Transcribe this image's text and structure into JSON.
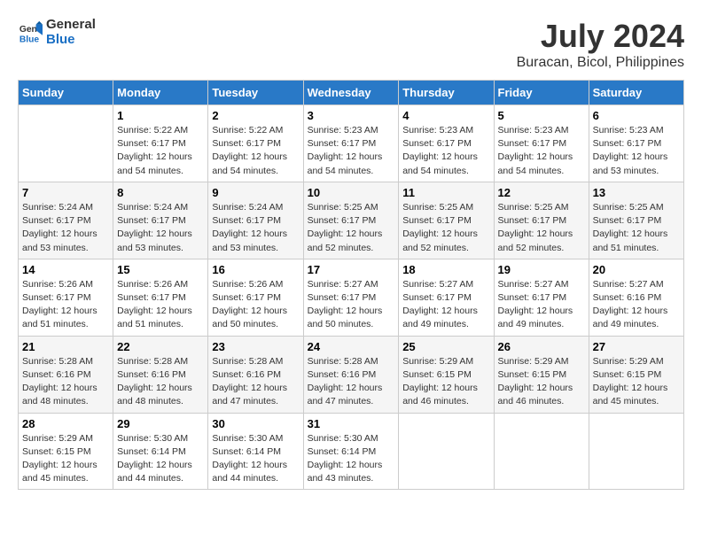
{
  "header": {
    "logo_general": "General",
    "logo_blue": "Blue",
    "title": "July 2024",
    "subtitle": "Buracan, Bicol, Philippines"
  },
  "days_of_week": [
    "Sunday",
    "Monday",
    "Tuesday",
    "Wednesday",
    "Thursday",
    "Friday",
    "Saturday"
  ],
  "weeks": [
    [
      {
        "day": "",
        "sunrise": "",
        "sunset": "",
        "daylight": ""
      },
      {
        "day": "1",
        "sunrise": "Sunrise: 5:22 AM",
        "sunset": "Sunset: 6:17 PM",
        "daylight": "Daylight: 12 hours and 54 minutes."
      },
      {
        "day": "2",
        "sunrise": "Sunrise: 5:22 AM",
        "sunset": "Sunset: 6:17 PM",
        "daylight": "Daylight: 12 hours and 54 minutes."
      },
      {
        "day": "3",
        "sunrise": "Sunrise: 5:23 AM",
        "sunset": "Sunset: 6:17 PM",
        "daylight": "Daylight: 12 hours and 54 minutes."
      },
      {
        "day": "4",
        "sunrise": "Sunrise: 5:23 AM",
        "sunset": "Sunset: 6:17 PM",
        "daylight": "Daylight: 12 hours and 54 minutes."
      },
      {
        "day": "5",
        "sunrise": "Sunrise: 5:23 AM",
        "sunset": "Sunset: 6:17 PM",
        "daylight": "Daylight: 12 hours and 54 minutes."
      },
      {
        "day": "6",
        "sunrise": "Sunrise: 5:23 AM",
        "sunset": "Sunset: 6:17 PM",
        "daylight": "Daylight: 12 hours and 53 minutes."
      }
    ],
    [
      {
        "day": "7",
        "sunrise": "Sunrise: 5:24 AM",
        "sunset": "Sunset: 6:17 PM",
        "daylight": "Daylight: 12 hours and 53 minutes."
      },
      {
        "day": "8",
        "sunrise": "Sunrise: 5:24 AM",
        "sunset": "Sunset: 6:17 PM",
        "daylight": "Daylight: 12 hours and 53 minutes."
      },
      {
        "day": "9",
        "sunrise": "Sunrise: 5:24 AM",
        "sunset": "Sunset: 6:17 PM",
        "daylight": "Daylight: 12 hours and 53 minutes."
      },
      {
        "day": "10",
        "sunrise": "Sunrise: 5:25 AM",
        "sunset": "Sunset: 6:17 PM",
        "daylight": "Daylight: 12 hours and 52 minutes."
      },
      {
        "day": "11",
        "sunrise": "Sunrise: 5:25 AM",
        "sunset": "Sunset: 6:17 PM",
        "daylight": "Daylight: 12 hours and 52 minutes."
      },
      {
        "day": "12",
        "sunrise": "Sunrise: 5:25 AM",
        "sunset": "Sunset: 6:17 PM",
        "daylight": "Daylight: 12 hours and 52 minutes."
      },
      {
        "day": "13",
        "sunrise": "Sunrise: 5:25 AM",
        "sunset": "Sunset: 6:17 PM",
        "daylight": "Daylight: 12 hours and 51 minutes."
      }
    ],
    [
      {
        "day": "14",
        "sunrise": "Sunrise: 5:26 AM",
        "sunset": "Sunset: 6:17 PM",
        "daylight": "Daylight: 12 hours and 51 minutes."
      },
      {
        "day": "15",
        "sunrise": "Sunrise: 5:26 AM",
        "sunset": "Sunset: 6:17 PM",
        "daylight": "Daylight: 12 hours and 51 minutes."
      },
      {
        "day": "16",
        "sunrise": "Sunrise: 5:26 AM",
        "sunset": "Sunset: 6:17 PM",
        "daylight": "Daylight: 12 hours and 50 minutes."
      },
      {
        "day": "17",
        "sunrise": "Sunrise: 5:27 AM",
        "sunset": "Sunset: 6:17 PM",
        "daylight": "Daylight: 12 hours and 50 minutes."
      },
      {
        "day": "18",
        "sunrise": "Sunrise: 5:27 AM",
        "sunset": "Sunset: 6:17 PM",
        "daylight": "Daylight: 12 hours and 49 minutes."
      },
      {
        "day": "19",
        "sunrise": "Sunrise: 5:27 AM",
        "sunset": "Sunset: 6:17 PM",
        "daylight": "Daylight: 12 hours and 49 minutes."
      },
      {
        "day": "20",
        "sunrise": "Sunrise: 5:27 AM",
        "sunset": "Sunset: 6:16 PM",
        "daylight": "Daylight: 12 hours and 49 minutes."
      }
    ],
    [
      {
        "day": "21",
        "sunrise": "Sunrise: 5:28 AM",
        "sunset": "Sunset: 6:16 PM",
        "daylight": "Daylight: 12 hours and 48 minutes."
      },
      {
        "day": "22",
        "sunrise": "Sunrise: 5:28 AM",
        "sunset": "Sunset: 6:16 PM",
        "daylight": "Daylight: 12 hours and 48 minutes."
      },
      {
        "day": "23",
        "sunrise": "Sunrise: 5:28 AM",
        "sunset": "Sunset: 6:16 PM",
        "daylight": "Daylight: 12 hours and 47 minutes."
      },
      {
        "day": "24",
        "sunrise": "Sunrise: 5:28 AM",
        "sunset": "Sunset: 6:16 PM",
        "daylight": "Daylight: 12 hours and 47 minutes."
      },
      {
        "day": "25",
        "sunrise": "Sunrise: 5:29 AM",
        "sunset": "Sunset: 6:15 PM",
        "daylight": "Daylight: 12 hours and 46 minutes."
      },
      {
        "day": "26",
        "sunrise": "Sunrise: 5:29 AM",
        "sunset": "Sunset: 6:15 PM",
        "daylight": "Daylight: 12 hours and 46 minutes."
      },
      {
        "day": "27",
        "sunrise": "Sunrise: 5:29 AM",
        "sunset": "Sunset: 6:15 PM",
        "daylight": "Daylight: 12 hours and 45 minutes."
      }
    ],
    [
      {
        "day": "28",
        "sunrise": "Sunrise: 5:29 AM",
        "sunset": "Sunset: 6:15 PM",
        "daylight": "Daylight: 12 hours and 45 minutes."
      },
      {
        "day": "29",
        "sunrise": "Sunrise: 5:30 AM",
        "sunset": "Sunset: 6:14 PM",
        "daylight": "Daylight: 12 hours and 44 minutes."
      },
      {
        "day": "30",
        "sunrise": "Sunrise: 5:30 AM",
        "sunset": "Sunset: 6:14 PM",
        "daylight": "Daylight: 12 hours and 44 minutes."
      },
      {
        "day": "31",
        "sunrise": "Sunrise: 5:30 AM",
        "sunset": "Sunset: 6:14 PM",
        "daylight": "Daylight: 12 hours and 43 minutes."
      },
      {
        "day": "",
        "sunrise": "",
        "sunset": "",
        "daylight": ""
      },
      {
        "day": "",
        "sunrise": "",
        "sunset": "",
        "daylight": ""
      },
      {
        "day": "",
        "sunrise": "",
        "sunset": "",
        "daylight": ""
      }
    ]
  ]
}
